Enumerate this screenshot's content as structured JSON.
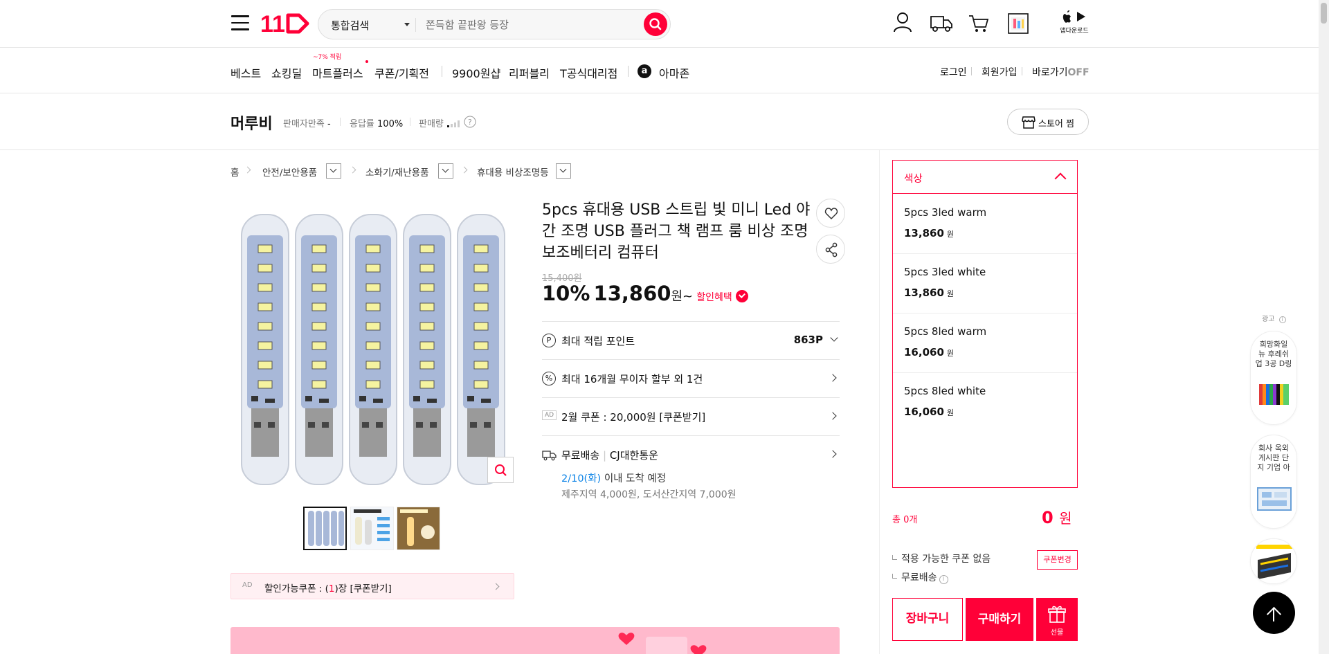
{
  "header": {
    "logo_text": "11",
    "search": {
      "scope": "통합검색",
      "placeholder": "쫀득함 끝판왕 등장"
    },
    "app_download": "앱다운로드"
  },
  "nav": {
    "items": [
      "베스트",
      "쇼킹딜",
      "마트플러스",
      "쿠폰/기획전",
      "9900원샵",
      "리퍼블리",
      "T공식대리점",
      "아마존"
    ],
    "mart_badge": "~7% 적립",
    "right": {
      "login": "로그인",
      "signup": "회원가입",
      "shortcut": "바로가기",
      "shortcut_state": "OFF"
    }
  },
  "seller": {
    "name": "머루비",
    "satisfaction_label": "판매자만족",
    "satisfaction_value": "-",
    "response_label": "응답률",
    "response_value": "100%",
    "sales_label": "판매량",
    "store_button": "스토어 찜"
  },
  "breadcrumb": [
    "홈",
    "안전/보안용품",
    "소화기/재난용품",
    "휴대용 비상조명등"
  ],
  "product": {
    "title": "5pcs 휴대용 USB 스트립 빛 미니 Led 야간 조명 USB 플러그 책 램프 룸 비상 조명 보조베터리 컴퓨터",
    "original_price": "15,400원",
    "discount_rate": "10%",
    "price": "13,860",
    "price_unit": "원~",
    "discount_benefit": "할인혜택",
    "points_label": "최대 적립 포인트",
    "points_value": "863P",
    "installment": "최대 16개월 무이자 할부 외 1건",
    "coupon_ad_tag": "AD",
    "coupon_text": "2월 쿠폰 : 20,000원 [쿠폰받기]",
    "shipping_free": "무료배송",
    "shipping_carrier": "CJ대한통운",
    "arrival_date": "2/10(화)",
    "arrival_text": "이내 도착 예정",
    "shipping_extra": "제주지역 4,000원, 도서산간지역 7,000원",
    "ad_coupon_tag": "AD",
    "ad_coupon_prefix": "할인가능쿠폰 : (",
    "ad_coupon_count": "1",
    "ad_coupon_suffix": ")장 [쿠폰받기]"
  },
  "options": {
    "header": "색상",
    "items": [
      {
        "name": "5pcs 3led warm",
        "price": "13,860",
        "unit": "원"
      },
      {
        "name": "5pcs 3led white",
        "price": "13,860",
        "unit": "원"
      },
      {
        "name": "5pcs 8led warm",
        "price": "16,060",
        "unit": "원"
      },
      {
        "name": "5pcs 8led white",
        "price": "16,060",
        "unit": "원"
      }
    ]
  },
  "order": {
    "total_label": "총 0개",
    "total_value": "0",
    "total_unit": "원",
    "coupon_none": "적용 가능한 쿠폰 없음",
    "coupon_change": "쿠폰변경",
    "free_shipping": "무료배송",
    "cart": "장바구니",
    "buy": "구매하기",
    "gift": "선물"
  },
  "side_ads": {
    "label": "광고",
    "items": [
      "희망화일 뉴 후레쉬 업 3공 D링",
      "회사 옥외 게시판 단지 기업 아"
    ]
  },
  "colors": {
    "accent": "#ff0038",
    "link": "#0b83e6"
  }
}
